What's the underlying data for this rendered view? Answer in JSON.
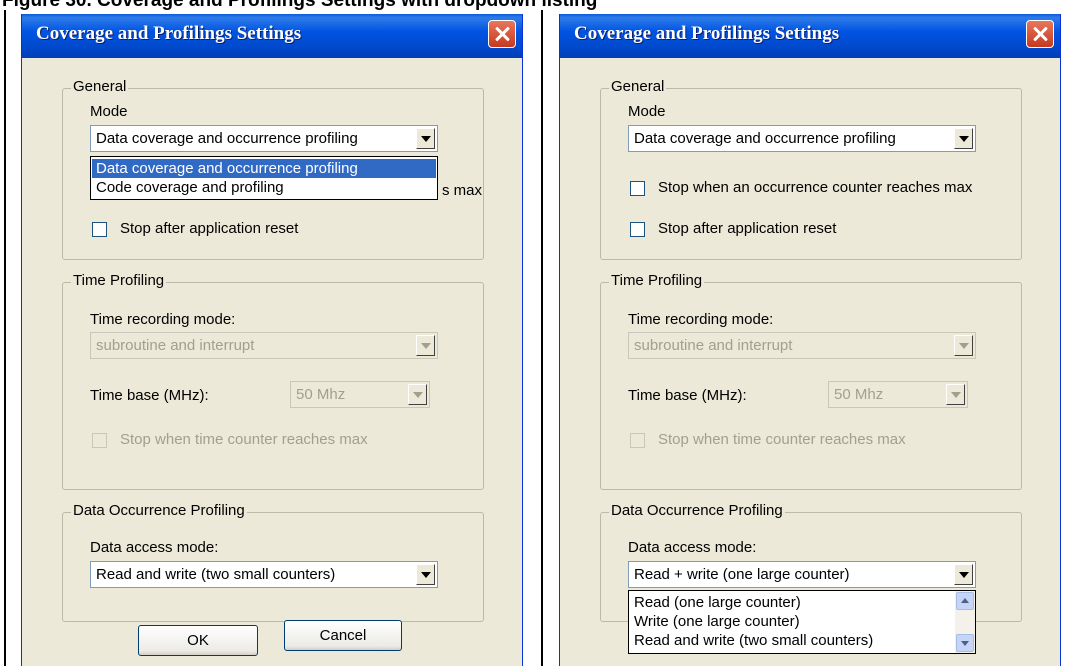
{
  "caption": "Figure 30. Coverage and Profilings Settings with dropdown listing",
  "left_dialog": {
    "title": "Coverage and Profilings Settings",
    "general": {
      "group_label": "General",
      "mode_label": "Mode",
      "mode_value": "Data coverage and occurrence profiling",
      "mode_options": [
        "Data coverage and occurrence profiling",
        "Code coverage and profiling"
      ],
      "stop_max_fragment": "s max",
      "stop_reset_label": "Stop after application reset"
    },
    "time_profiling": {
      "group_label": "Time Profiling",
      "recording_mode_label": "Time recording mode:",
      "recording_mode_value": "subroutine and interrupt",
      "time_base_label": "Time base (MHz):",
      "time_base_value": "50 Mhz",
      "stop_time_label": "Stop when time counter reaches max"
    },
    "data_occurrence": {
      "group_label": "Data Occurrence Profiling",
      "access_mode_label": "Data access mode:",
      "access_mode_value": "Read and write (two small counters)"
    },
    "ok_label": "OK",
    "cancel_label": "Cancel"
  },
  "right_dialog": {
    "title": "Coverage and Profilings Settings",
    "general": {
      "group_label": "General",
      "mode_label": "Mode",
      "mode_value": "Data coverage and occurrence profiling",
      "stop_max_label": "Stop when an occurrence counter reaches max",
      "stop_reset_label": "Stop after application reset"
    },
    "time_profiling": {
      "group_label": "Time Profiling",
      "recording_mode_label": "Time recording mode:",
      "recording_mode_value": "subroutine and interrupt",
      "time_base_label": "Time base (MHz):",
      "time_base_value": "50 Mhz",
      "stop_time_label": "Stop when time counter reaches max"
    },
    "data_occurrence": {
      "group_label": "Data Occurrence Profiling",
      "access_mode_label": "Data access mode:",
      "access_mode_value": "Read + write (one large counter)",
      "access_mode_options": [
        "Read (one large counter)",
        "Write (one large counter)",
        "Read and write (two small counters)"
      ]
    }
  },
  "colors": {
    "titlebar": "#0054e3",
    "dialog_bg": "#ece9d8",
    "selection": "#316ac5",
    "close_button": "#d9553a"
  },
  "icons": [
    "close-icon",
    "dropdown-arrow-icon",
    "scroll-up-icon",
    "scroll-down-icon"
  ]
}
